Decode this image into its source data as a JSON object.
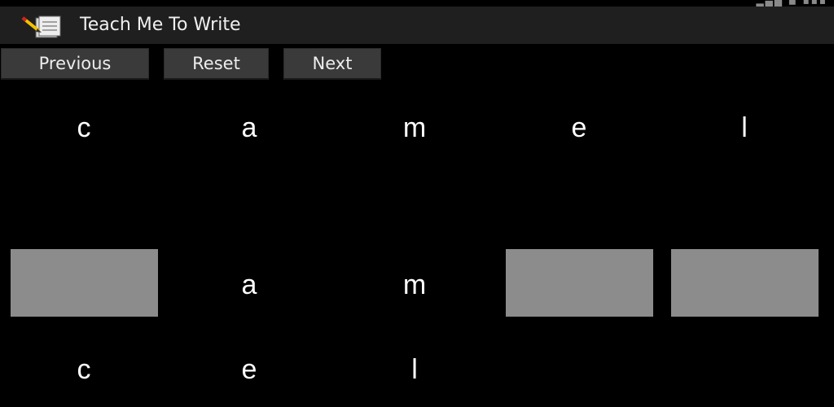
{
  "app": {
    "title": "Teach Me To Write",
    "icon": "notepad-pencil-icon"
  },
  "toolbar": {
    "previous_label": "Previous",
    "reset_label": "Reset",
    "next_label": "Next",
    "button_color": "#3a3a3a"
  },
  "target_word": {
    "letters": [
      "c",
      "a",
      "m",
      "e",
      "l"
    ]
  },
  "answer_row": {
    "slots": [
      {
        "letter": "",
        "filled": false
      },
      {
        "letter": "a",
        "filled": true
      },
      {
        "letter": "m",
        "filled": true
      },
      {
        "letter": "",
        "filled": false
      },
      {
        "letter": "",
        "filled": false
      }
    ],
    "empty_slot_color": "#8c8c8c"
  },
  "letter_pool": {
    "letters": [
      "c",
      "e",
      "l"
    ]
  },
  "colors": {
    "background": "#000000",
    "action_bar": "#1f1f1f",
    "text": "#ffffff"
  }
}
